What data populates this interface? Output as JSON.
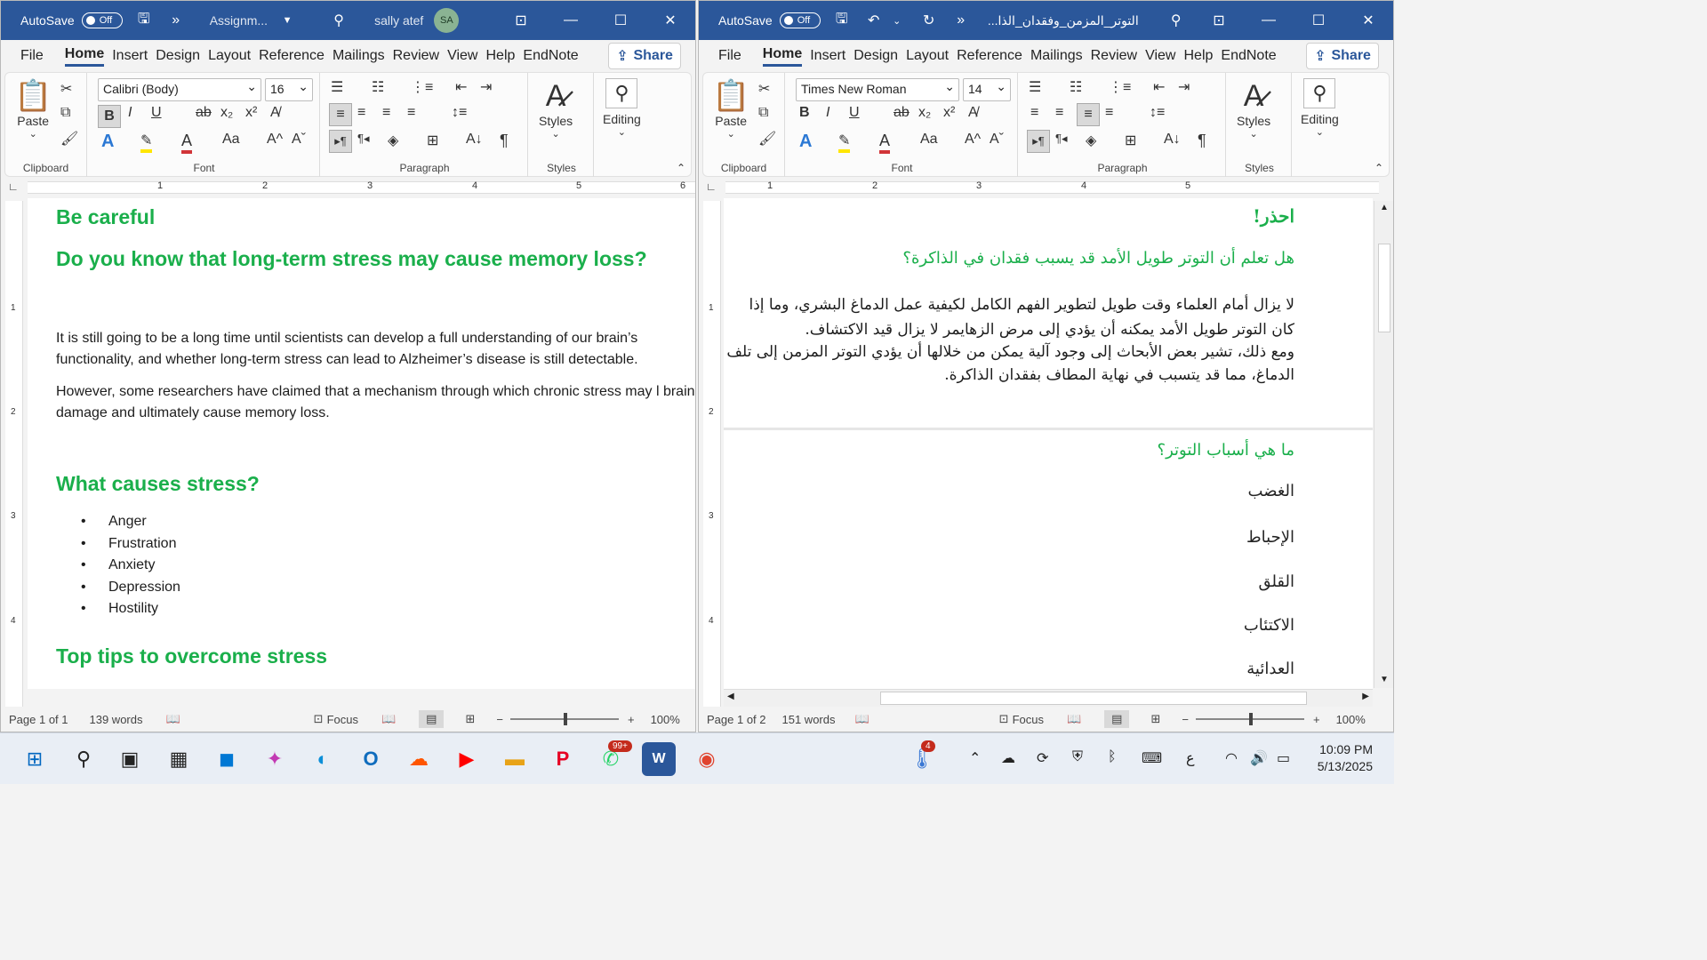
{
  "left": {
    "autosave_label": "AutoSave",
    "autosave_state": "Off",
    "title": "Assignm...",
    "user": "sally atef",
    "avatar_initials": "SA",
    "menu": [
      "File",
      "Home",
      "Insert",
      "Design",
      "Layout",
      "Reference",
      "Mailings",
      "Review",
      "View",
      "Help",
      "EndNote"
    ],
    "share": "Share",
    "font_name": "Calibri (Body)",
    "font_size": "16",
    "group_clipboard": "Clipboard",
    "group_font": "Font",
    "group_paragraph": "Paragraph",
    "group_styles": "Styles",
    "paste": "Paste",
    "styles": "Styles",
    "editing": "Editing",
    "ruler_nums": [
      "1",
      "2",
      "3",
      "4",
      "5",
      "6"
    ],
    "vruler_nums": [
      "1",
      "2",
      "3",
      "4"
    ],
    "doc": {
      "h1": "Be careful",
      "h2": "Do you know that long-term stress may cause memory loss?",
      "p1": "It is still going to be a long time until scientists can develop a full understanding of our brain’s functionality, and whether long-term stress can lead to Alzheimer’s disease is still detectable.",
      "p2": "However, some researchers have claimed that a mechanism through which chronic stress may l brain damage and ultimately cause memory loss.",
      "h3": "What causes stress?",
      "list": [
        "Anger",
        "Frustration",
        "Anxiety",
        "Depression",
        "Hostility"
      ],
      "h4": "Top tips to overcome stress"
    },
    "status": {
      "page": "Page 1 of 1",
      "words": "139 words",
      "focus": "Focus",
      "zoom": "100%"
    }
  },
  "right": {
    "autosave_label": "AutoSave",
    "autosave_state": "Off",
    "title": "التوتر_المزمن_وفقدان_الذا...",
    "menu": [
      "File",
      "Home",
      "Insert",
      "Design",
      "Layout",
      "Reference",
      "Mailings",
      "Review",
      "View",
      "Help",
      "EndNote"
    ],
    "share": "Share",
    "font_name": "Times New Roman",
    "font_size": "14",
    "group_clipboard": "Clipboard",
    "group_font": "Font",
    "group_paragraph": "Paragraph",
    "group_styles": "Styles",
    "paste": "Paste",
    "styles": "Styles",
    "editing": "Editing",
    "ruler_nums": [
      "1",
      "2",
      "3",
      "4",
      "5"
    ],
    "vruler_nums": [
      "1",
      "2",
      "3",
      "4"
    ],
    "doc": {
      "h1": "احذر!",
      "h2": "هل تعلم أن التوتر طويل الأمد قد يسبب فقدان في الذاكرة؟",
      "p1": "لا يزال أمام العلماء وقت طويل لتطوير الفهم الكامل لكيفية عمل الدماغ البشري، وما إذا كان التوتر طويل الأمد يمكنه أن يؤدي إلى مرض الزهايمر لا يزال قيد الاكتشاف.",
      "p2": "ومع ذلك، تشير بعض الأبحاث إلى وجود آلية يمكن من خلالها أن يؤدي التوتر المزمن إلى تلف الدماغ، مما قد يتسبب في نهاية المطاف بفقدان الذاكرة.",
      "h3": "ما هي أسباب التوتر؟",
      "list": [
        "الغضب",
        "الإحباط",
        "القلق",
        "الاكتئاب",
        "العدائية"
      ]
    },
    "status": {
      "page": "Page 1 of 2",
      "words": "151 words",
      "focus": "Focus",
      "zoom": "100%"
    }
  },
  "taskbar": {
    "whatsapp_badge": "99+",
    "weather_badge": "4",
    "lang": "ع",
    "time": "10:09 PM",
    "date": "5/13/2025"
  }
}
